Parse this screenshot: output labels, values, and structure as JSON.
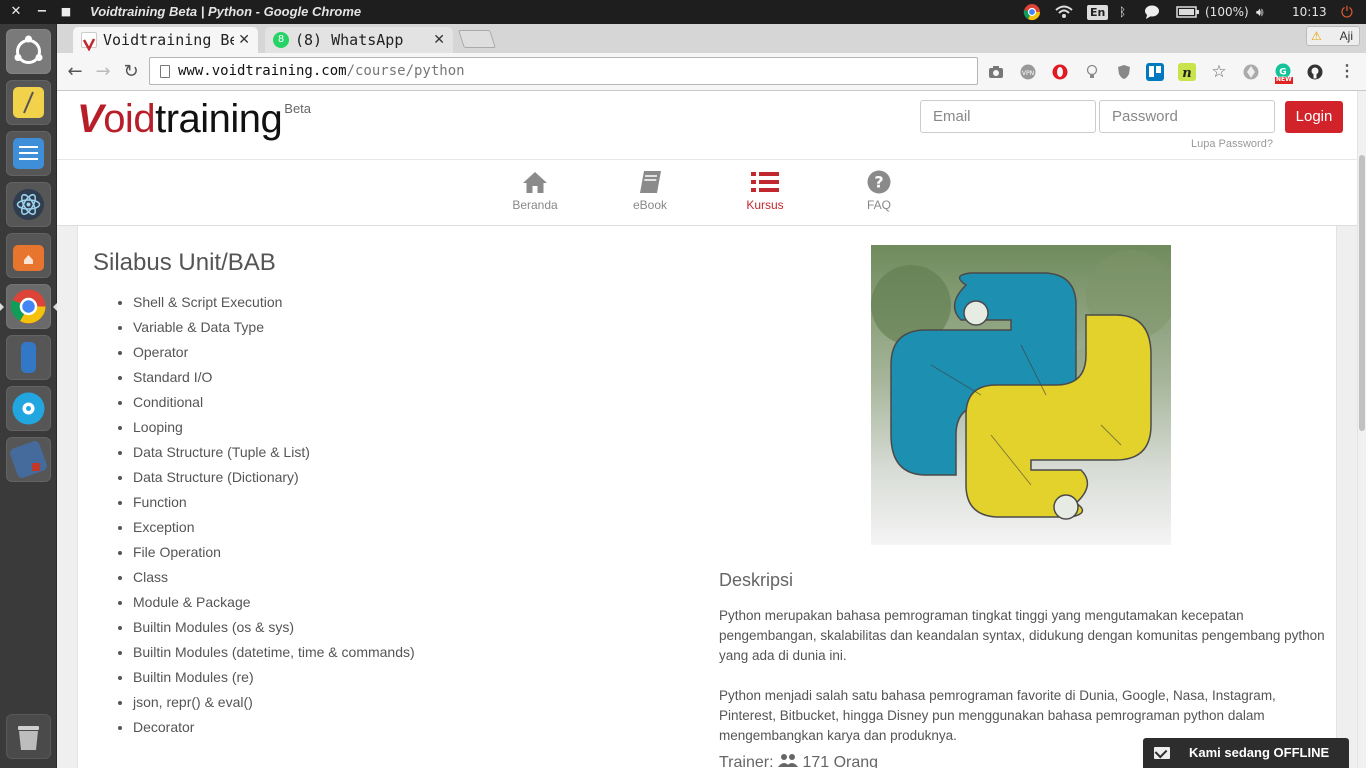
{
  "os": {
    "window_title": "Voidtraining Beta | Python - Google Chrome",
    "keyboard_layout": "En",
    "battery": "(100%)",
    "clock": "10:13"
  },
  "launcher": {
    "items": [
      "ubuntu-dash-icon",
      "notes-icon",
      "text-editor-icon",
      "atom-icon",
      "files-icon",
      "chrome-icon",
      "phone-icon",
      "disk-icon",
      "book-icon",
      "trash-icon"
    ]
  },
  "browser": {
    "tabs": [
      {
        "label": "Voidtraining Be",
        "active": true
      },
      {
        "label": "(8) WhatsApp",
        "active": false
      }
    ],
    "whatsapp_badge": "8",
    "profile_name": "Aji",
    "url_host": "www.voidtraining.com",
    "url_path": "/course/python",
    "extension_new_badge": "NEW"
  },
  "site": {
    "logo_v": "V",
    "logo_oid": "oid",
    "logo_rest": "training",
    "logo_beta": "Beta",
    "email_placeholder": "Email",
    "password_placeholder": "Password",
    "login_label": "Login",
    "forgot_label": "Lupa Password?",
    "nav": [
      {
        "label": "Beranda",
        "icon": "home-icon"
      },
      {
        "label": "eBook",
        "icon": "book-icon"
      },
      {
        "label": "Kursus",
        "icon": "list-icon",
        "active": true
      },
      {
        "label": "FAQ",
        "icon": "question-icon"
      }
    ],
    "accent_color": "#d2232a"
  },
  "course": {
    "syllabus_title": "Silabus Unit/BAB",
    "syllabus": [
      "Shell & Script Execution",
      "Variable & Data Type",
      "Operator",
      "Standard I/O",
      "Conditional",
      "Looping",
      "Data Structure (Tuple & List)",
      "Data Structure (Dictionary)",
      "Function",
      "Exception",
      "File Operation",
      "Class",
      "Module & Package",
      "Builtin Modules (os & sys)",
      "Builtin Modules (datetime, time & commands)",
      "Builtin Modules (re)",
      "json, repr() & eval()",
      "Decorator"
    ],
    "description_title": "Deskripsi",
    "description_p1": "Python merupakan bahasa pemrograman tingkat tinggi yang mengutamakan kecepatan pengembangan, skalabilitas dan keandalan syntax, didukung dengan komunitas pengembang python yang ada di dunia ini.",
    "description_p2": "Python menjadi salah satu bahasa pemrograman favorite di Dunia, Google, Nasa, Instagram, Pinterest, Bitbucket, hingga Disney pun menggunakan bahasa pemrograman python dalam mengembangkan karya dan produknya.",
    "trainer_label": "Trainer:",
    "trainer_count": "171 Orang"
  },
  "chat": {
    "label": "Kami sedang OFFLINE"
  }
}
